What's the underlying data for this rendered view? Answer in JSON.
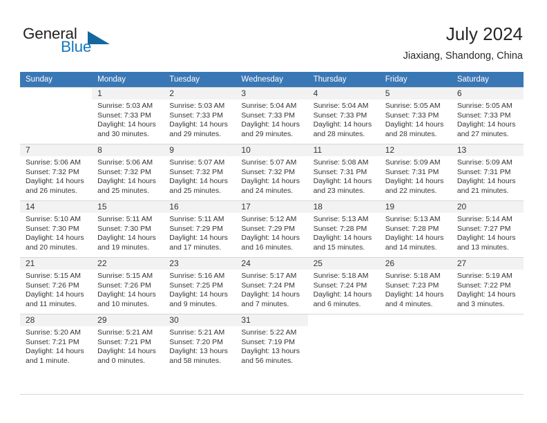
{
  "logo": {
    "word_one": "General",
    "word_two": "Blue",
    "triangle_icon": "triangle-icon"
  },
  "header": {
    "title": "July 2024",
    "subtitle": "Jiaxiang, Shandong, China",
    "accent_color": "#3a77b5",
    "logo_blue": "#1477bf"
  },
  "calendar": {
    "weekday_headers": [
      "Sunday",
      "Monday",
      "Tuesday",
      "Wednesday",
      "Thursday",
      "Friday",
      "Saturday"
    ],
    "weeks": [
      [
        {
          "day": "",
          "sunrise": "",
          "sunset": "",
          "daylight_line1": "",
          "daylight_line2": ""
        },
        {
          "day": "1",
          "sunrise": "Sunrise: 5:03 AM",
          "sunset": "Sunset: 7:33 PM",
          "daylight_line1": "Daylight: 14 hours",
          "daylight_line2": "and 30 minutes."
        },
        {
          "day": "2",
          "sunrise": "Sunrise: 5:03 AM",
          "sunset": "Sunset: 7:33 PM",
          "daylight_line1": "Daylight: 14 hours",
          "daylight_line2": "and 29 minutes."
        },
        {
          "day": "3",
          "sunrise": "Sunrise: 5:04 AM",
          "sunset": "Sunset: 7:33 PM",
          "daylight_line1": "Daylight: 14 hours",
          "daylight_line2": "and 29 minutes."
        },
        {
          "day": "4",
          "sunrise": "Sunrise: 5:04 AM",
          "sunset": "Sunset: 7:33 PM",
          "daylight_line1": "Daylight: 14 hours",
          "daylight_line2": "and 28 minutes."
        },
        {
          "day": "5",
          "sunrise": "Sunrise: 5:05 AM",
          "sunset": "Sunset: 7:33 PM",
          "daylight_line1": "Daylight: 14 hours",
          "daylight_line2": "and 28 minutes."
        },
        {
          "day": "6",
          "sunrise": "Sunrise: 5:05 AM",
          "sunset": "Sunset: 7:33 PM",
          "daylight_line1": "Daylight: 14 hours",
          "daylight_line2": "and 27 minutes."
        }
      ],
      [
        {
          "day": "7",
          "sunrise": "Sunrise: 5:06 AM",
          "sunset": "Sunset: 7:32 PM",
          "daylight_line1": "Daylight: 14 hours",
          "daylight_line2": "and 26 minutes."
        },
        {
          "day": "8",
          "sunrise": "Sunrise: 5:06 AM",
          "sunset": "Sunset: 7:32 PM",
          "daylight_line1": "Daylight: 14 hours",
          "daylight_line2": "and 25 minutes."
        },
        {
          "day": "9",
          "sunrise": "Sunrise: 5:07 AM",
          "sunset": "Sunset: 7:32 PM",
          "daylight_line1": "Daylight: 14 hours",
          "daylight_line2": "and 25 minutes."
        },
        {
          "day": "10",
          "sunrise": "Sunrise: 5:07 AM",
          "sunset": "Sunset: 7:32 PM",
          "daylight_line1": "Daylight: 14 hours",
          "daylight_line2": "and 24 minutes."
        },
        {
          "day": "11",
          "sunrise": "Sunrise: 5:08 AM",
          "sunset": "Sunset: 7:31 PM",
          "daylight_line1": "Daylight: 14 hours",
          "daylight_line2": "and 23 minutes."
        },
        {
          "day": "12",
          "sunrise": "Sunrise: 5:09 AM",
          "sunset": "Sunset: 7:31 PM",
          "daylight_line1": "Daylight: 14 hours",
          "daylight_line2": "and 22 minutes."
        },
        {
          "day": "13",
          "sunrise": "Sunrise: 5:09 AM",
          "sunset": "Sunset: 7:31 PM",
          "daylight_line1": "Daylight: 14 hours",
          "daylight_line2": "and 21 minutes."
        }
      ],
      [
        {
          "day": "14",
          "sunrise": "Sunrise: 5:10 AM",
          "sunset": "Sunset: 7:30 PM",
          "daylight_line1": "Daylight: 14 hours",
          "daylight_line2": "and 20 minutes."
        },
        {
          "day": "15",
          "sunrise": "Sunrise: 5:11 AM",
          "sunset": "Sunset: 7:30 PM",
          "daylight_line1": "Daylight: 14 hours",
          "daylight_line2": "and 19 minutes."
        },
        {
          "day": "16",
          "sunrise": "Sunrise: 5:11 AM",
          "sunset": "Sunset: 7:29 PM",
          "daylight_line1": "Daylight: 14 hours",
          "daylight_line2": "and 17 minutes."
        },
        {
          "day": "17",
          "sunrise": "Sunrise: 5:12 AM",
          "sunset": "Sunset: 7:29 PM",
          "daylight_line1": "Daylight: 14 hours",
          "daylight_line2": "and 16 minutes."
        },
        {
          "day": "18",
          "sunrise": "Sunrise: 5:13 AM",
          "sunset": "Sunset: 7:28 PM",
          "daylight_line1": "Daylight: 14 hours",
          "daylight_line2": "and 15 minutes."
        },
        {
          "day": "19",
          "sunrise": "Sunrise: 5:13 AM",
          "sunset": "Sunset: 7:28 PM",
          "daylight_line1": "Daylight: 14 hours",
          "daylight_line2": "and 14 minutes."
        },
        {
          "day": "20",
          "sunrise": "Sunrise: 5:14 AM",
          "sunset": "Sunset: 7:27 PM",
          "daylight_line1": "Daylight: 14 hours",
          "daylight_line2": "and 13 minutes."
        }
      ],
      [
        {
          "day": "21",
          "sunrise": "Sunrise: 5:15 AM",
          "sunset": "Sunset: 7:26 PM",
          "daylight_line1": "Daylight: 14 hours",
          "daylight_line2": "and 11 minutes."
        },
        {
          "day": "22",
          "sunrise": "Sunrise: 5:15 AM",
          "sunset": "Sunset: 7:26 PM",
          "daylight_line1": "Daylight: 14 hours",
          "daylight_line2": "and 10 minutes."
        },
        {
          "day": "23",
          "sunrise": "Sunrise: 5:16 AM",
          "sunset": "Sunset: 7:25 PM",
          "daylight_line1": "Daylight: 14 hours",
          "daylight_line2": "and 9 minutes."
        },
        {
          "day": "24",
          "sunrise": "Sunrise: 5:17 AM",
          "sunset": "Sunset: 7:24 PM",
          "daylight_line1": "Daylight: 14 hours",
          "daylight_line2": "and 7 minutes."
        },
        {
          "day": "25",
          "sunrise": "Sunrise: 5:18 AM",
          "sunset": "Sunset: 7:24 PM",
          "daylight_line1": "Daylight: 14 hours",
          "daylight_line2": "and 6 minutes."
        },
        {
          "day": "26",
          "sunrise": "Sunrise: 5:18 AM",
          "sunset": "Sunset: 7:23 PM",
          "daylight_line1": "Daylight: 14 hours",
          "daylight_line2": "and 4 minutes."
        },
        {
          "day": "27",
          "sunrise": "Sunrise: 5:19 AM",
          "sunset": "Sunset: 7:22 PM",
          "daylight_line1": "Daylight: 14 hours",
          "daylight_line2": "and 3 minutes."
        }
      ],
      [
        {
          "day": "28",
          "sunrise": "Sunrise: 5:20 AM",
          "sunset": "Sunset: 7:21 PM",
          "daylight_line1": "Daylight: 14 hours",
          "daylight_line2": "and 1 minute."
        },
        {
          "day": "29",
          "sunrise": "Sunrise: 5:21 AM",
          "sunset": "Sunset: 7:21 PM",
          "daylight_line1": "Daylight: 14 hours",
          "daylight_line2": "and 0 minutes."
        },
        {
          "day": "30",
          "sunrise": "Sunrise: 5:21 AM",
          "sunset": "Sunset: 7:20 PM",
          "daylight_line1": "Daylight: 13 hours",
          "daylight_line2": "and 58 minutes."
        },
        {
          "day": "31",
          "sunrise": "Sunrise: 5:22 AM",
          "sunset": "Sunset: 7:19 PM",
          "daylight_line1": "Daylight: 13 hours",
          "daylight_line2": "and 56 minutes."
        },
        {
          "day": "",
          "sunrise": "",
          "sunset": "",
          "daylight_line1": "",
          "daylight_line2": ""
        },
        {
          "day": "",
          "sunrise": "",
          "sunset": "",
          "daylight_line1": "",
          "daylight_line2": ""
        },
        {
          "day": "",
          "sunrise": "",
          "sunset": "",
          "daylight_line1": "",
          "daylight_line2": ""
        }
      ]
    ]
  }
}
